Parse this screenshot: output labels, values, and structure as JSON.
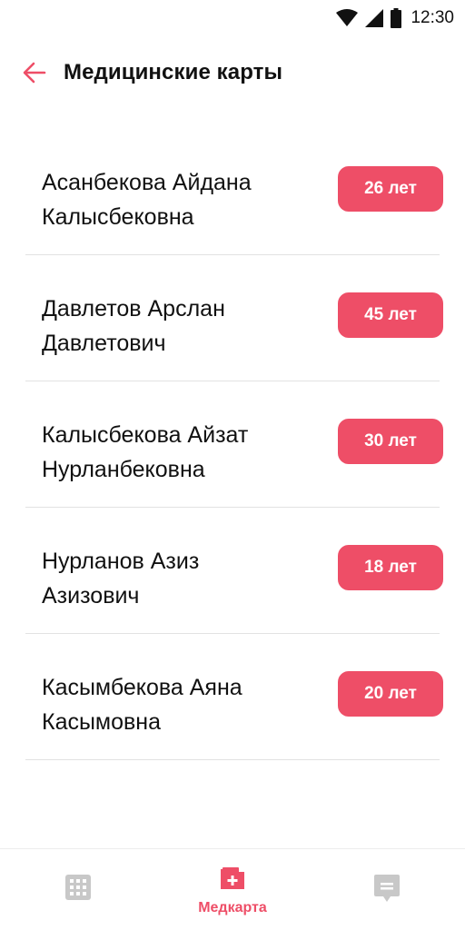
{
  "status_bar": {
    "time": "12:30"
  },
  "header": {
    "title": "Медицинские карты"
  },
  "patients": [
    {
      "name_line1": "Асанбекова Айдана",
      "name_line2": "Калысбековна",
      "age": "26 лет"
    },
    {
      "name_line1": "Давлетов Арслан",
      "name_line2": "Давлетович",
      "age": "45 лет"
    },
    {
      "name_line1": "Калысбекова Айзат",
      "name_line2": "Нурланбековна",
      "age": "30 лет"
    },
    {
      "name_line1": "Нурланов Азиз",
      "name_line2": "Азизович",
      "age": "18 лет"
    },
    {
      "name_line1": "Касымбекова Аяна",
      "name_line2": "Касымовна",
      "age": "20 лет"
    }
  ],
  "bottom_nav": {
    "items": [
      {
        "icon": "grid-icon",
        "active": false
      },
      {
        "icon": "medical-folder-icon",
        "label": "Медкарта",
        "active": true
      },
      {
        "icon": "chat-icon",
        "active": false
      }
    ]
  },
  "colors": {
    "accent": "#ee4e67",
    "inactive": "#c8c8c8",
    "divider": "#e2e2e2"
  }
}
